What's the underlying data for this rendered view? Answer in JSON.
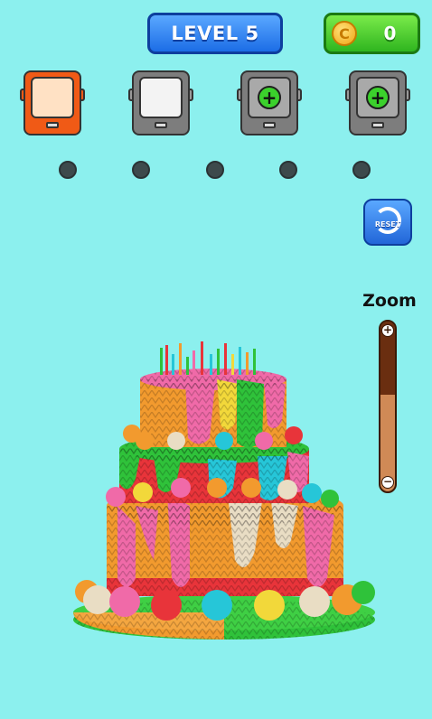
{
  "header": {
    "level_label": "LEVEL 5",
    "coins": "0",
    "coin_symbol": "C"
  },
  "slots": [
    {
      "state": "filled",
      "color": "#ffe1c4",
      "frame": "#f05a16"
    },
    {
      "state": "filled",
      "color": "#f3f3f3",
      "frame": "#7d7d7d"
    },
    {
      "state": "locked",
      "icon": "plus-icon",
      "symbol": "+"
    },
    {
      "state": "locked",
      "icon": "plus-icon",
      "symbol": "+"
    }
  ],
  "queue_dots": 5,
  "reset": {
    "label": "RESET",
    "icon": "reset-arrow-icon"
  },
  "zoom": {
    "label": "Zoom",
    "plus": "+",
    "minus": "−",
    "level": 0.43
  },
  "colors": {
    "background": "#8cf0ee",
    "orange": "#f29a2e",
    "pink": "#f06aa8",
    "green": "#2fc23a",
    "cyan": "#26c6d8",
    "red": "#e8343a",
    "beige": "#e9ddc4",
    "yellow": "#f2d83a"
  }
}
